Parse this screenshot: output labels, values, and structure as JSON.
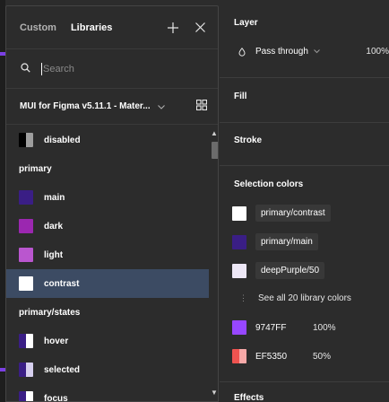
{
  "popover": {
    "tabs": [
      {
        "label": "Custom",
        "active": false
      },
      {
        "label": "Libraries",
        "active": true
      }
    ],
    "icons": {
      "add": "plus-icon",
      "close": "close-icon",
      "search": "search-icon",
      "grid": "grid-view-icon"
    },
    "search_placeholder": "Search",
    "library": {
      "name": "MUI for Figma v5.11.1 - Mater...",
      "chevron": "chevron-down-icon"
    },
    "items": [
      {
        "kind": "swatch",
        "label": "disabled",
        "swatch": "split-dark"
      },
      {
        "kind": "section",
        "label": "primary"
      },
      {
        "kind": "swatch",
        "label": "main",
        "color": "#3a1e85"
      },
      {
        "kind": "swatch",
        "label": "dark",
        "color": "#9b27b0"
      },
      {
        "kind": "swatch",
        "label": "light",
        "color": "#ba56cf"
      },
      {
        "kind": "swatch",
        "label": "contrast",
        "color": "#ffffff",
        "selected": true
      },
      {
        "kind": "section",
        "label": "primary/states"
      },
      {
        "kind": "swatch",
        "label": "hover",
        "swatch": "split-purple"
      },
      {
        "kind": "swatch",
        "label": "selected",
        "swatch": "split-purple2"
      },
      {
        "kind": "swatch",
        "label": "focus",
        "swatch": "split-purple"
      }
    ]
  },
  "panel": {
    "layer": {
      "title": "Layer",
      "blend_mode": "Pass through",
      "opacity": "100%"
    },
    "fill": {
      "title": "Fill"
    },
    "stroke": {
      "title": "Stroke"
    },
    "selection_colors": {
      "title": "Selection colors",
      "styles": [
        {
          "label": "primary/contrast",
          "color": "#ffffff"
        },
        {
          "label": "primary/main",
          "color": "#3a1e85"
        },
        {
          "label": "deepPurple/50",
          "color": "#ede7f6"
        }
      ],
      "see_all": "See all 20 library colors",
      "raw": [
        {
          "hex": "9747FF",
          "opacity": "100%",
          "color": "#9747ff"
        },
        {
          "hex": "EF5350",
          "opacity": "50%",
          "color": "#ef5350"
        }
      ]
    },
    "effects": {
      "title": "Effects"
    }
  }
}
